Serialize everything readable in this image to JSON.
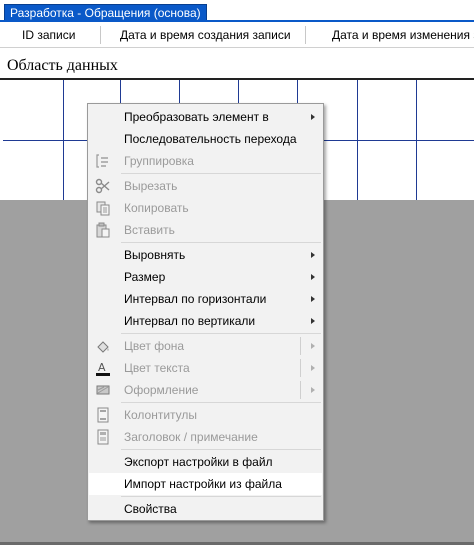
{
  "window": {
    "title": "Разработка - Обращения (основа)"
  },
  "table_header": {
    "columns": [
      "ID записи",
      "Дата и время создания записи",
      "Дата и время изменения з"
    ]
  },
  "section": {
    "title": "Область данных"
  },
  "context_menu": {
    "items": [
      {
        "label": "Преобразовать элемент в",
        "enabled": true,
        "submenu": true,
        "icon": null
      },
      {
        "label": "Последовательность перехода",
        "enabled": true,
        "submenu": false,
        "icon": null
      },
      {
        "label": "Группировка",
        "enabled": false,
        "submenu": false,
        "icon": "group-icon"
      },
      {
        "label": "Вырезать",
        "enabled": false,
        "submenu": false,
        "icon": "scissors-icon"
      },
      {
        "label": "Копировать",
        "enabled": false,
        "submenu": false,
        "icon": "copy-icon"
      },
      {
        "label": "Вставить",
        "enabled": false,
        "submenu": false,
        "icon": "paste-icon"
      },
      {
        "label": "Выровнять",
        "enabled": true,
        "submenu": true,
        "icon": null
      },
      {
        "label": "Размер",
        "enabled": true,
        "submenu": true,
        "icon": null
      },
      {
        "label": "Интервал по горизонтали",
        "enabled": true,
        "submenu": true,
        "icon": null
      },
      {
        "label": "Интервал по вертикали",
        "enabled": true,
        "submenu": true,
        "icon": null
      },
      {
        "label": "Цвет фона",
        "enabled": false,
        "submenu": true,
        "icon": "fill-color-icon"
      },
      {
        "label": "Цвет текста",
        "enabled": false,
        "submenu": true,
        "icon": "font-color-icon"
      },
      {
        "label": "Оформление",
        "enabled": false,
        "submenu": true,
        "icon": "special-effect-icon"
      },
      {
        "label": "Колонтитулы",
        "enabled": false,
        "submenu": false,
        "icon": "header-footer-icon"
      },
      {
        "label": "Заголовок / примечание",
        "enabled": false,
        "submenu": false,
        "icon": "report-header-icon"
      },
      {
        "label": "Экспорт настройки в файл",
        "enabled": true,
        "submenu": false,
        "icon": null
      },
      {
        "label": "Импорт настройки из файла",
        "enabled": true,
        "submenu": false,
        "icon": null,
        "highlighted": true
      },
      {
        "label": "Свойства",
        "enabled": true,
        "submenu": false,
        "icon": null
      }
    ]
  },
  "colors": {
    "title_bar": "#0a59c8",
    "grid_lines": "#1f3a93",
    "menu_background": "#f2f2f2",
    "disabled_text": "#9a9a9a",
    "gray_area": "#a0a0a0"
  }
}
